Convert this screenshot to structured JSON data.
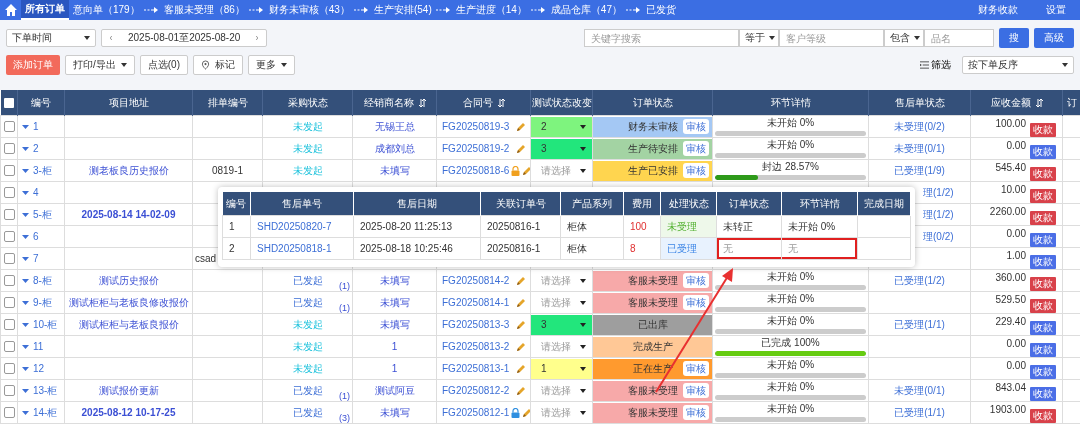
{
  "nav": {
    "tabs": [
      {
        "label": "所有订单",
        "selected": true,
        "arrow": false
      },
      {
        "label": "意向单（179）",
        "selected": false,
        "arrow": false
      },
      {
        "label": "客服未受理（86）",
        "selected": false,
        "arrow": true
      },
      {
        "label": "财务未审核（43）",
        "selected": false,
        "arrow": true
      },
      {
        "label": "生产安排(54)",
        "selected": false,
        "arrow": true
      },
      {
        "label": "生产进度（14）",
        "selected": false,
        "arrow": true
      },
      {
        "label": "成品仓库（47）",
        "selected": false,
        "arrow": true
      },
      {
        "label": "已发货",
        "selected": false,
        "arrow": true
      }
    ],
    "right_links": [
      "财务收款",
      "设置"
    ]
  },
  "filters": {
    "time_select": "下单时间",
    "date_range": "2025-08-01至2025-08-20",
    "keyword": {
      "placeholder": "关键字搜索"
    },
    "op1": "等于",
    "level": {
      "placeholder": "客户等级"
    },
    "op2": "包含",
    "product": {
      "placeholder": "品名"
    },
    "search_button": "搜",
    "advanced_button": "高级"
  },
  "actions": {
    "add": "添加订单",
    "print": "打印/导出",
    "pick": "点选(0)",
    "mark": "标记",
    "more": "更多",
    "filter": "筛选",
    "sort": "按下单反序"
  },
  "table": {
    "columns": [
      "编号",
      "项目地址",
      "排单编号",
      "采购状态",
      "经销商名称",
      "合同号",
      "测试状态改变",
      "订单状态",
      "环节详情",
      "售后单状态",
      "应收金额",
      "订"
    ],
    "sortable": [
      false,
      false,
      false,
      false,
      true,
      true,
      false,
      false,
      false,
      false,
      true,
      false
    ],
    "all_checked": false,
    "row_checked": [
      false,
      false,
      false,
      false,
      false,
      false,
      false,
      false,
      false,
      false,
      false,
      false,
      false,
      false
    ],
    "rows": [
      {
        "no": "1",
        "address": "",
        "plan": "",
        "purchase": {
          "text": "未发起",
          "initiated": false
        },
        "dealer": "无锡王总",
        "contract": "FG20250819-3",
        "test": {
          "value": "2",
          "color": "#7ef47e"
        },
        "status": {
          "text": "财务未审核",
          "color": "#a4c8f4",
          "review": "审核"
        },
        "step": {
          "text": "未开始 0%",
          "level": 0
        },
        "after_sale": {
          "text": "未受理(0/2)",
          "clipped": false
        },
        "amount": "100.00",
        "pay": {
          "label": "收款",
          "color": "#d8414a"
        }
      },
      {
        "no": "2",
        "address": "",
        "plan": "",
        "purchase": {
          "text": "未发起",
          "initiated": false
        },
        "dealer": "成都刘总",
        "contract": "FG20250819-2",
        "test": {
          "value": "3",
          "color": "#22e67c"
        },
        "status": {
          "text": "生产待安排",
          "color": "#a3d3a3",
          "review": "审核"
        },
        "step": {
          "text": "未开始 0%",
          "level": 0
        },
        "after_sale": {
          "text": "未受理(0/1)",
          "clipped": false
        },
        "amount": "0.00",
        "pay": {
          "label": "收款",
          "color": "#4b6ee6"
        }
      },
      {
        "no": "3-柜",
        "address": "测老板良历史报价",
        "plan": "0819-1",
        "purchase": {
          "text": "未发起",
          "initiated": false
        },
        "dealer": "未填写",
        "contract": "FG20250818-6",
        "lock": {
          "color": "#f0a01e"
        },
        "test": {
          "placeholder": "请选择"
        },
        "status": {
          "text": "生产已安排",
          "color": "#ffd54f",
          "review": "审核"
        },
        "step": {
          "text": "封边 28.57%",
          "level": 0.2857
        },
        "after_sale": {
          "text": "已受理(1/9)",
          "clipped": false
        },
        "amount": "545.40",
        "pay": {
          "label": "收款",
          "color": "#d8414a"
        }
      },
      {
        "no": "4",
        "covered": true,
        "after_sale": {
          "text": "理(1/2)",
          "clipped": true
        },
        "amount": "10.00",
        "pay": {
          "label": "收款",
          "color": "#d8414a"
        }
      },
      {
        "no": "5-柜",
        "covered": true,
        "address": "2025-08-14 14-02-09",
        "address_bold": true,
        "after_sale": {
          "text": "理(1/2)",
          "clipped": true
        },
        "amount": "2260.00",
        "pay": {
          "label": "收款",
          "color": "#d8414a"
        }
      },
      {
        "no": "6",
        "covered": true,
        "after_sale": {
          "text": "理(0/2)",
          "clipped": true
        },
        "amount": "0.00",
        "pay": {
          "label": "收款",
          "color": "#4b6ee6"
        }
      },
      {
        "no": "7",
        "covered": true,
        "plan": "csad",
        "plan_clipped": true,
        "amount": "1.00",
        "pay": {
          "label": "收款",
          "color": "#4b6ee6"
        }
      },
      {
        "no": "8-柜",
        "address": "测试历史报价",
        "plan": "",
        "purchase": {
          "text": "已发起",
          "initiated": true,
          "count": "(1)"
        },
        "dealer": "未填写",
        "contract": "FG20250814-2",
        "test": {
          "placeholder": "请选择"
        },
        "status": {
          "text": "客服未受理",
          "color": "#f7a9a9",
          "review": "审核"
        },
        "step": {
          "text": "未开始 0%",
          "level": 0
        },
        "after_sale": {
          "text": "已受理(1/2)",
          "clipped": false
        },
        "amount": "360.00",
        "pay": {
          "label": "收款",
          "color": "#d8414a"
        }
      },
      {
        "no": "9-柜",
        "address": "测试柜柜与老板良修改报价",
        "plan": "",
        "purchase": {
          "text": "已发起",
          "initiated": true,
          "count": "(1)"
        },
        "dealer": "未填写",
        "contract": "FG20250814-1",
        "test": {
          "placeholder": "请选择"
        },
        "status": {
          "text": "客服未受理",
          "color": "#f7a9a9",
          "review": "审核"
        },
        "step": {
          "text": "未开始 0%",
          "level": 0
        },
        "amount": "529.50",
        "pay": {
          "label": "收款",
          "color": "#d8414a"
        }
      },
      {
        "no": "10-柜",
        "address": "测试柜柜与老板良报价",
        "plan": "",
        "purchase": {
          "text": "未发起",
          "initiated": false
        },
        "dealer": "未填写",
        "contract": "FG20250813-3",
        "test": {
          "value": "3",
          "color": "#22e67c"
        },
        "status": {
          "text": "已出库",
          "color": "#9e9e9e"
        },
        "step": {
          "text": "未开始 0%",
          "level": 0
        },
        "after_sale": {
          "text": "已受理(1/1)",
          "clipped": false
        },
        "amount": "229.40",
        "pay": {
          "label": "收款",
          "color": "#4b6ee6"
        }
      },
      {
        "no": "11",
        "address": "",
        "plan": "",
        "purchase": {
          "text": "未发起",
          "initiated": false
        },
        "dealer": "1",
        "contract": "FG20250813-2",
        "test": {
          "placeholder": "请选择"
        },
        "status": {
          "text": "完成生产",
          "color": "#ffc896"
        },
        "step": {
          "text": "已完成 100%",
          "level": 1
        },
        "amount": "0.00",
        "pay": {
          "label": "收款",
          "color": "#4b6ee6"
        }
      },
      {
        "no": "12",
        "address": "",
        "plan": "",
        "purchase": {
          "text": "未发起",
          "initiated": false
        },
        "dealer": "1",
        "contract": "FG20250813-1",
        "test": {
          "value": "1",
          "color": "#ffff8c"
        },
        "status": {
          "text": "正在生产",
          "color": "#ff9a2e",
          "review": "审核"
        },
        "step": {
          "text": "未开始 0%",
          "level": 0
        },
        "amount": "0.00",
        "pay": {
          "label": "收款",
          "color": "#4b6ee6"
        }
      },
      {
        "no": "13-柜",
        "address": "测试报价更新",
        "plan": "",
        "purchase": {
          "text": "已发起",
          "initiated": true,
          "count": "(1)"
        },
        "dealer": "测试阿豆",
        "contract": "FG20250812-2",
        "test": {
          "placeholder": "请选择"
        },
        "status": {
          "text": "客服未受理",
          "color": "#f7a9a9",
          "review": "审核"
        },
        "step": {
          "text": "未开始 0%",
          "level": 0
        },
        "after_sale": {
          "text": "未受理(0/1)",
          "clipped": false
        },
        "amount": "843.04",
        "pay": {
          "label": "收款",
          "color": "#4b6ee6"
        }
      },
      {
        "no": "14-柜",
        "address": "2025-08-12 10-17-25",
        "address_bold": true,
        "plan": "",
        "purchase": {
          "text": "已发起",
          "initiated": true,
          "count": "(3)"
        },
        "dealer": "未填写",
        "contract": "FG20250812-1",
        "lock": {
          "color": "#2f8fe0"
        },
        "test": {
          "placeholder": "请选择"
        },
        "status": {
          "text": "客服未受理",
          "color": "#f7a9a9",
          "review": "审核"
        },
        "step": {
          "text": "未开始 0%",
          "level": 0
        },
        "after_sale": {
          "text": "已受理(1/1)",
          "clipped": false
        },
        "amount": "1903.00",
        "pay": {
          "label": "收款",
          "color": "#d8414a"
        }
      }
    ]
  },
  "popup": {
    "columns": [
      "编号",
      "售后单号",
      "售后日期",
      "关联订单号",
      "产品系列",
      "费用",
      "处理状态",
      "订单状态",
      "环节详情",
      "完成日期"
    ],
    "rows": [
      {
        "no": "1",
        "order": "SHD20250820-7",
        "date": "2025-08-20 11:25:13",
        "related": "20250816-1",
        "series": "柜体",
        "fee": "100",
        "handling": {
          "text": "未受理",
          "accepted": false
        },
        "order_status": "未转正",
        "step": "未开始  0%",
        "highlighted": false
      },
      {
        "no": "2",
        "order": "SHD20250818-1",
        "date": "2025-08-18 10:25:46",
        "related": "20250816-1",
        "series": "柜体",
        "fee": "8",
        "handling": {
          "text": "已受理",
          "accepted": true
        },
        "order_status": "无",
        "step": "无",
        "highlighted": true
      }
    ]
  }
}
